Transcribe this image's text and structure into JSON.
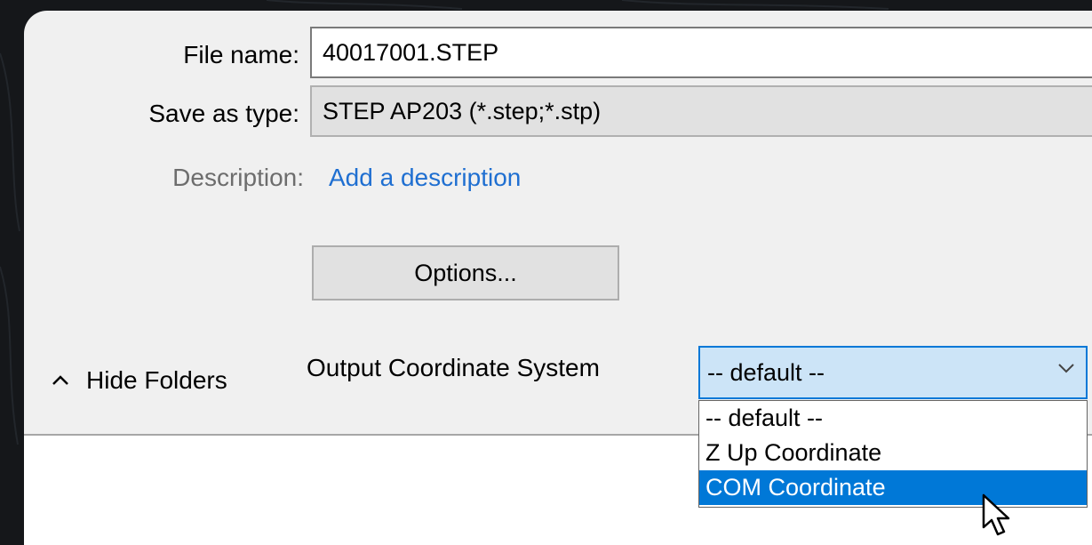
{
  "dialog": {
    "file_name_label": "File name:",
    "file_name_value": "40017001.STEP",
    "save_as_type_label": "Save as type:",
    "save_as_type_value": "STEP AP203 (*.step;*.stp)",
    "description_label": "Description:",
    "description_link": "Add a description",
    "options_button": "Options...",
    "hide_folders": "Hide Folders",
    "output_coord_label": "Output Coordinate System",
    "combo": {
      "selected": "-- default --",
      "options": [
        "-- default --",
        "Z Up Coordinate",
        "COM Coordinate"
      ],
      "highlighted_index": 2
    }
  },
  "colors": {
    "dialog_bg": "#f0f0f0",
    "accent": "#0078d7",
    "link": "#1f6fd1",
    "combo_bg": "#cce4f7"
  },
  "icons": {
    "hide_folders": "chevron-up-icon",
    "combo": "chevron-down-icon",
    "cursor": "mouse-pointer-icon"
  }
}
